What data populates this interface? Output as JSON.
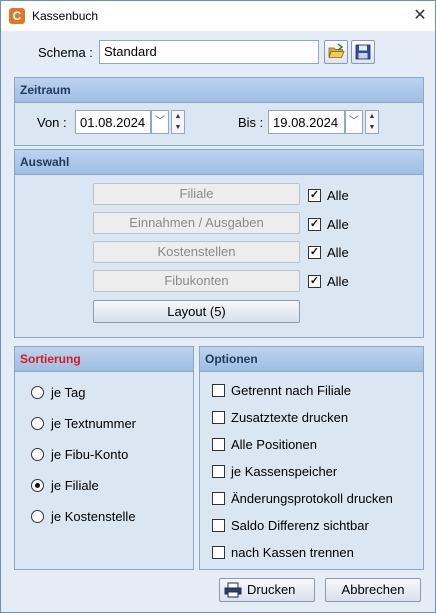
{
  "window": {
    "title": "Kassenbuch",
    "close_glyph": "✕",
    "app_icon_letter": "C"
  },
  "schema": {
    "label": "Schema :",
    "value": "Standard"
  },
  "zeitraum": {
    "header": "Zeitraum",
    "von_label": "Von :",
    "von_value": "01.08.2024",
    "bis_label": "Bis :",
    "bis_value": "19.08.2024"
  },
  "auswahl": {
    "header": "Auswahl",
    "items": [
      {
        "label": "Filiale",
        "all_label": "Alle",
        "checked": true
      },
      {
        "label": "Einnahmen / Ausgaben",
        "all_label": "Alle",
        "checked": true
      },
      {
        "label": "Kostenstellen",
        "all_label": "Alle",
        "checked": true
      },
      {
        "label": "Fibukonten",
        "all_label": "Alle",
        "checked": true
      }
    ],
    "layout_button": "Layout (5)"
  },
  "sortierung": {
    "header": "Sortierung",
    "header_color": "#d81b1b",
    "options": [
      "je Tag",
      "je Textnummer",
      "je Fibu-Konto",
      "je Filiale",
      "je Kostenstelle"
    ],
    "selected": "je Filiale"
  },
  "optionen": {
    "header": "Optionen",
    "items": [
      {
        "label": "Getrennt nach Filiale",
        "checked": false
      },
      {
        "label": "Zusatztexte drucken",
        "checked": false
      },
      {
        "label": "Alle Positionen",
        "checked": false
      },
      {
        "label": "je Kassenspeicher",
        "checked": false
      },
      {
        "label": "Änderungsprotokoll drucken",
        "checked": false
      },
      {
        "label": "Saldo Differenz sichtbar",
        "checked": false
      },
      {
        "label": "nach Kassen trennen",
        "checked": false
      }
    ]
  },
  "footer": {
    "print_button": "Drucken",
    "cancel_button": "Abbrechen"
  },
  "check_glyph": "✓",
  "icons": [
    "app-icon",
    "close-icon",
    "folder-open-icon",
    "save-icon",
    "chevron-down-icon",
    "spin-up-icon",
    "spin-down-icon",
    "printer-icon"
  ]
}
